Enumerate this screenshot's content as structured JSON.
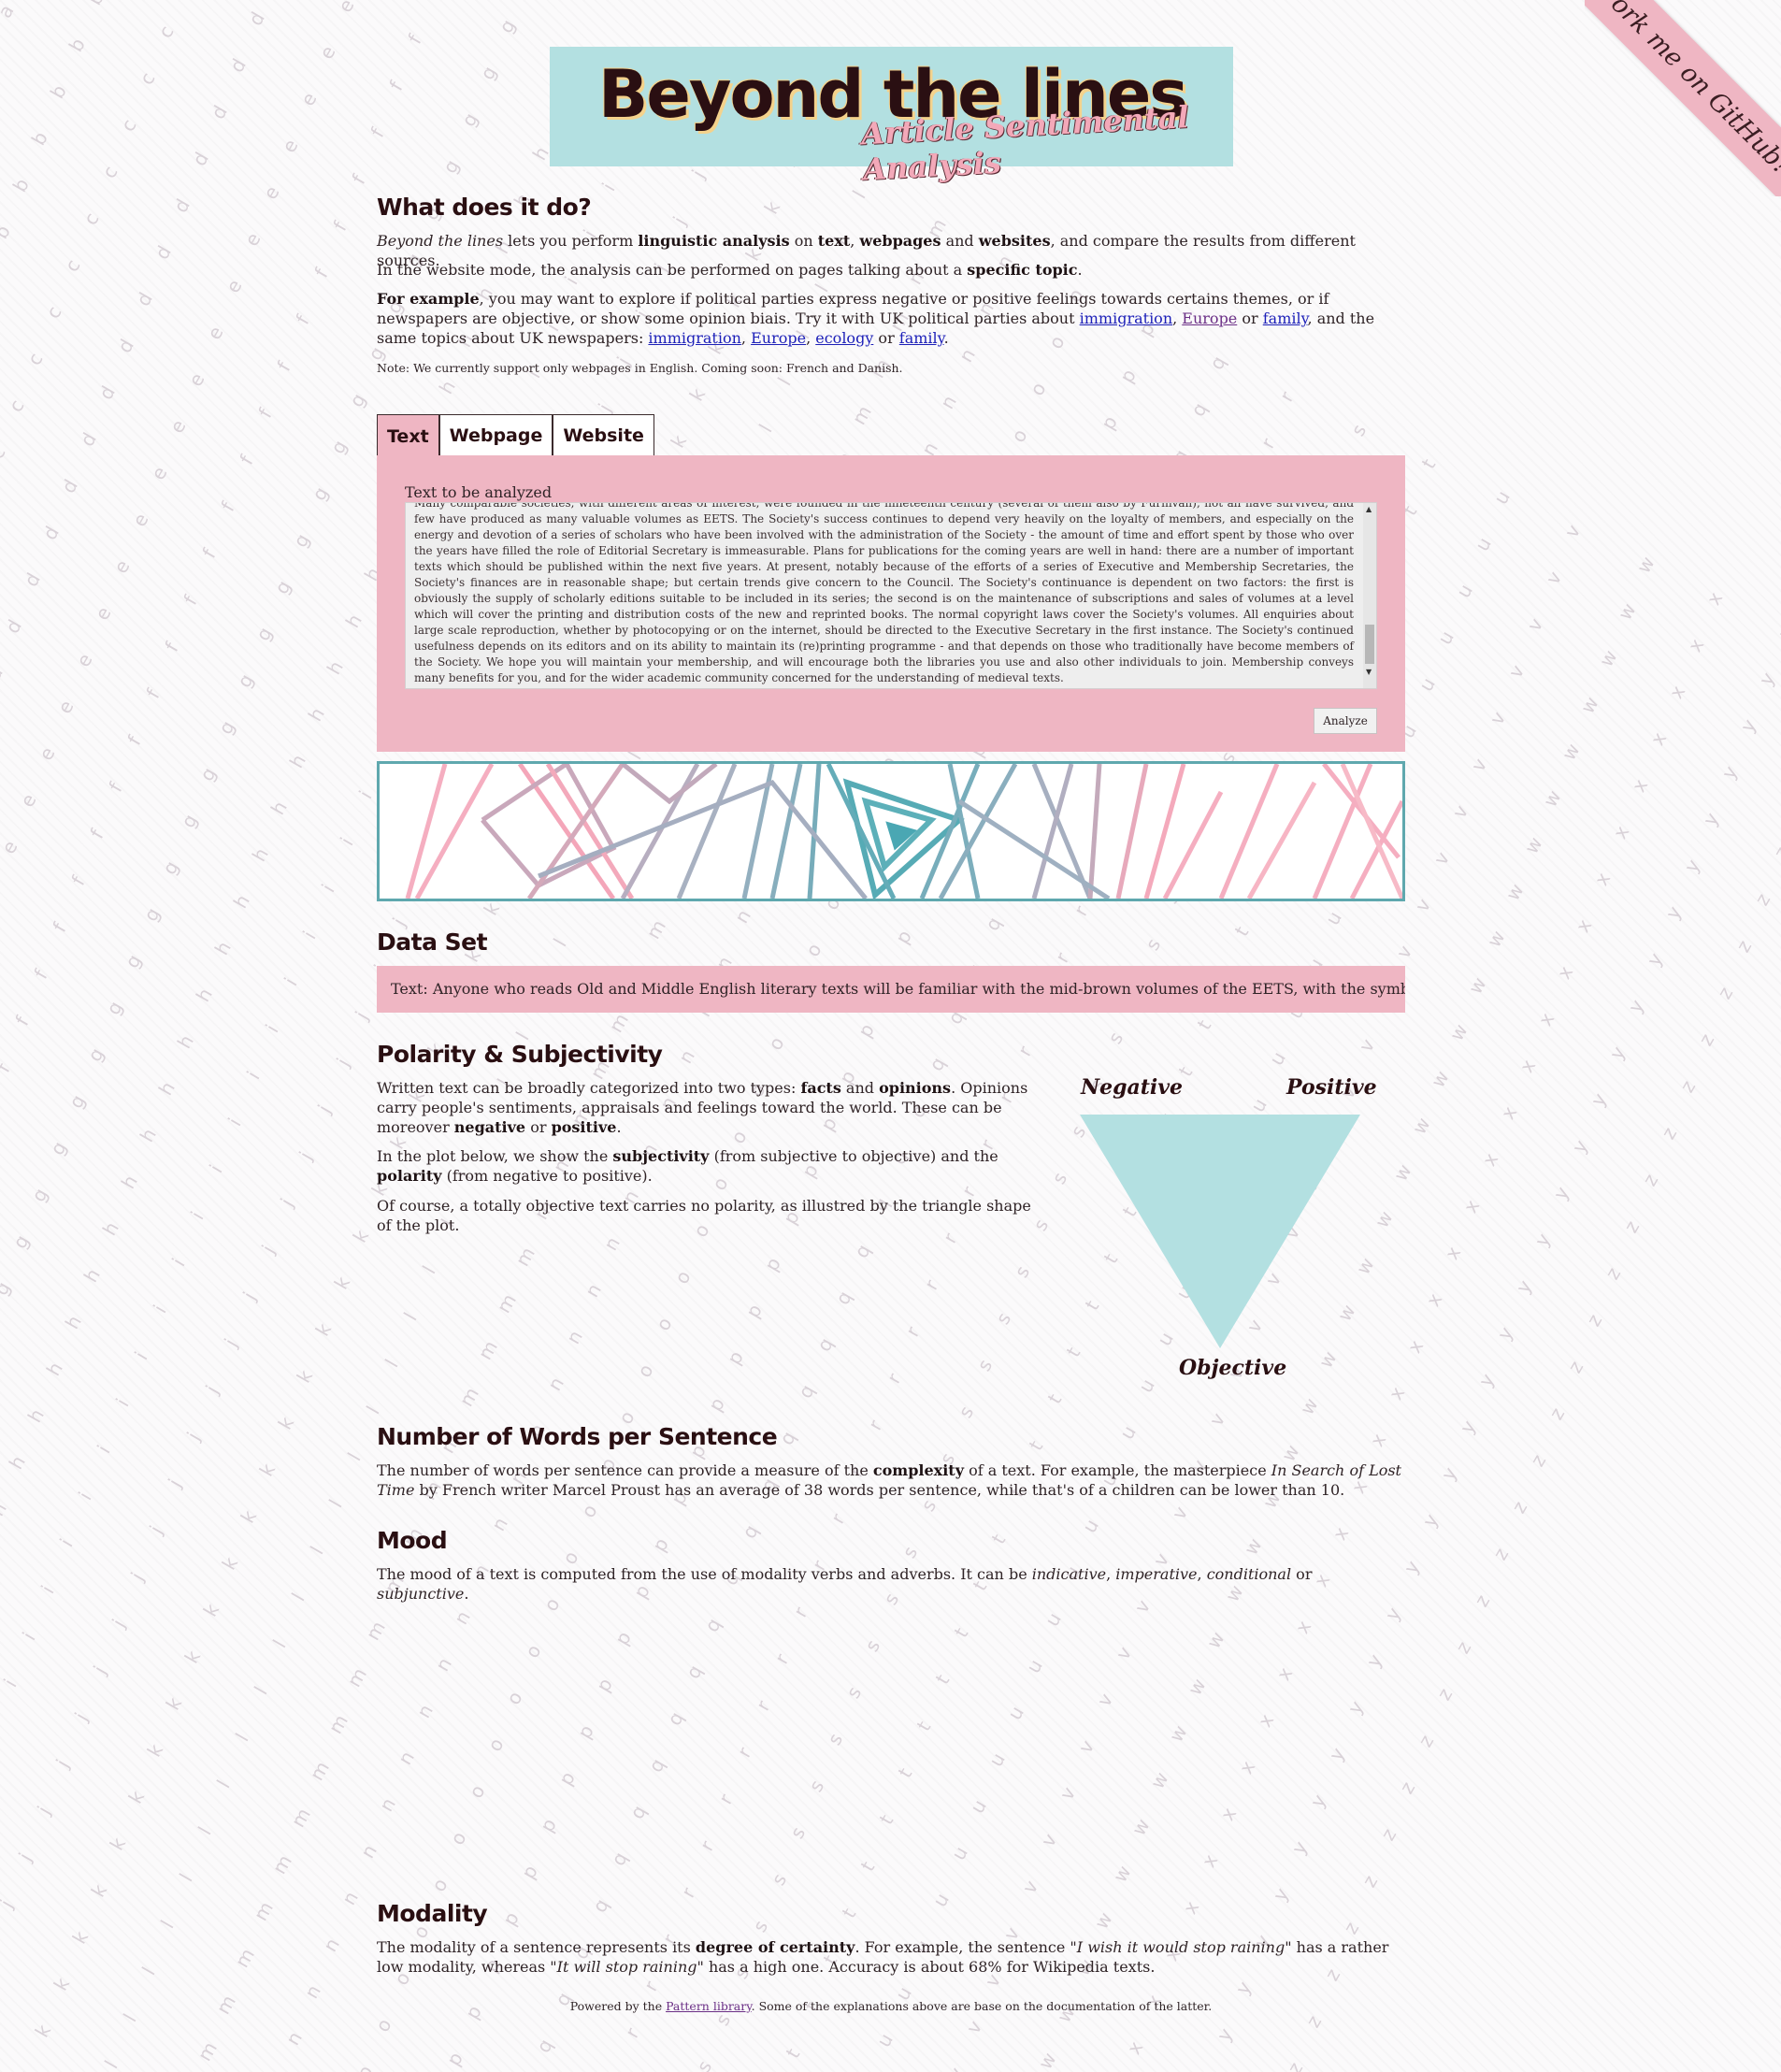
{
  "ribbon": {
    "label": "Fork me on GitHub!"
  },
  "banner": {
    "title": "Beyond the lines",
    "subtitle": "Article Sentimental Analysis"
  },
  "what": {
    "heading": "What does it do?",
    "p1": {
      "em": "Beyond the lines",
      "t1": " lets you perform ",
      "b1": "linguistic analysis",
      "t2": " on ",
      "b2": "text",
      "t3": ", ",
      "b3": "webpages",
      "t4": " and ",
      "b4": "websites",
      "t5": ", and compare the results from different sources."
    },
    "p2": {
      "t1": "In the website mode, the analysis can be performed on pages talking about a ",
      "b1": "specific topic",
      "t2": "."
    },
    "p3": {
      "b1": "For example",
      "t1": ", you may want to explore if political parties express negative or positive feelings towards certains themes, or if newspapers are objective, or show some opinion biais. Try it with UK political parties about ",
      "l1": "immigration",
      "t2": ", ",
      "l2": "Europe",
      "t3": " or ",
      "l3": "family",
      "t4": ", and the same topics about UK newspapers: ",
      "l4": "immigration",
      "t5": ", ",
      "l5": "Europe",
      "t6": ", ",
      "l6": "ecology",
      "t7": " or ",
      "l7": "family",
      "t8": "."
    },
    "note": "Note: We currently support only webpages in English. Coming soon: French and Danish."
  },
  "tabs": [
    "Text",
    "Webpage",
    "Website"
  ],
  "form": {
    "label": "Text to be analyzed",
    "value": "Many comparable societies, with different areas of interest, were founded in the nineteenth century (several of them also by Furnivall), not all have survived, and few have produced as many valuable volumes as EETS. The Society's success continues to depend very heavily on the loyalty of members, and especially on the energy and devotion of a series of scholars who have been involved with the administration of the Society - the amount of time and effort spent by those who over the years have filled the role of Editorial Secretary is immeasurable. Plans for publications for the coming years are well in hand: there are a number of important texts which should be published within the next five years. At present, notably because of the efforts of a series of Executive and Membership Secretaries, the Society's finances are in reasonable shape; but certain trends give concern to the Council. The Society's continuance is dependent on two factors: the first is obviously the supply of scholarly editions suitable to be included in its series; the second is on the maintenance of subscriptions and sales of volumes at a level which will cover the printing and distribution costs of the new and reprinted books. The normal copyright laws cover the Society's volumes. All enquiries about large scale reproduction, whether by photocopying or on the internet, should be directed to the Executive Secretary in the first instance. The Society's continued usefulness depends on its editors and on its ability to maintain its (re)printing programme - and that depends on those who traditionally have become members of the Society. We hope you will maintain your membership, and will encourage both the libraries you use and also other individuals to join. Membership conveys many benefits for you, and for the wider academic community concerned for the understanding of medieval texts.",
    "button": "Analyze"
  },
  "dataset": {
    "heading": "Data Set",
    "text": "Text: Anyone who reads Old and Middle English literary texts will be familiar with the mid-brown volumes of the EETS, with the symbol of Alfred's jewel embossed on the cover."
  },
  "polarity": {
    "heading": "Polarity & Subjectivity",
    "p1": {
      "t1": "Written text can be broadly categorized into two types: ",
      "b1": "facts",
      "t2": " and ",
      "b2": "opinions",
      "t3": ". Opinions carry people's sentiments, appraisals and feelings toward the world. These can be moreover ",
      "b3": "negative",
      "t4": " or ",
      "b4": "positive",
      "t5": "."
    },
    "p2": {
      "t1": "In the plot below, we show the ",
      "b1": "subjectivity",
      "t2": " (from subjective to objective) and the ",
      "b2": "polarity",
      "t3": " (from negative to positive)."
    },
    "p3": "Of course, a totally objective text carries no polarity, as illustred by the triangle shape of the plot.",
    "plot": {
      "negative": "Negative",
      "positive": "Positive",
      "objective": "Objective",
      "fill": "#b3e0e1"
    }
  },
  "words": {
    "heading": "Number of Words per Sentence",
    "p1": {
      "t1": "The number of words per sentence can provide a measure of the ",
      "b1": "complexity",
      "t2": " of a text. For example, the masterpiece ",
      "em1": "In Search of Lost Time",
      "t3": " by French writer Marcel Proust has an average of 38 words per sentence, while that's of a children can be lower than 10."
    }
  },
  "mood": {
    "heading": "Mood",
    "p1": {
      "t1": "The mood of a text is computed from the use of modality verbs and adverbs. It can be ",
      "em1": "indicative",
      "t2": ", ",
      "em2": "imperative",
      "t3": ", ",
      "em3": "conditional",
      "t4": " or ",
      "em4": "subjunctive",
      "t5": "."
    }
  },
  "modality": {
    "heading": "Modality",
    "p1": {
      "t1": "The modality of a sentence represents its ",
      "b1": "degree of certainty",
      "t2": ". For example, the sentence \"",
      "em1": "I wish it would stop raining",
      "t3": "\" has a rather low modality, whereas \"",
      "em2": "It will stop raining",
      "t4": "\" has a high one. Accuracy is about 68% for Wikipedia texts."
    }
  },
  "footer": {
    "t1": "Powered by the ",
    "link": "Pattern library",
    "t2": ". Some of the explanations above are base on the documentation of the latter."
  },
  "colors": {
    "pink": "#efb6c3",
    "teal": "#b3e0e1",
    "dark": "#2a0f12"
  }
}
